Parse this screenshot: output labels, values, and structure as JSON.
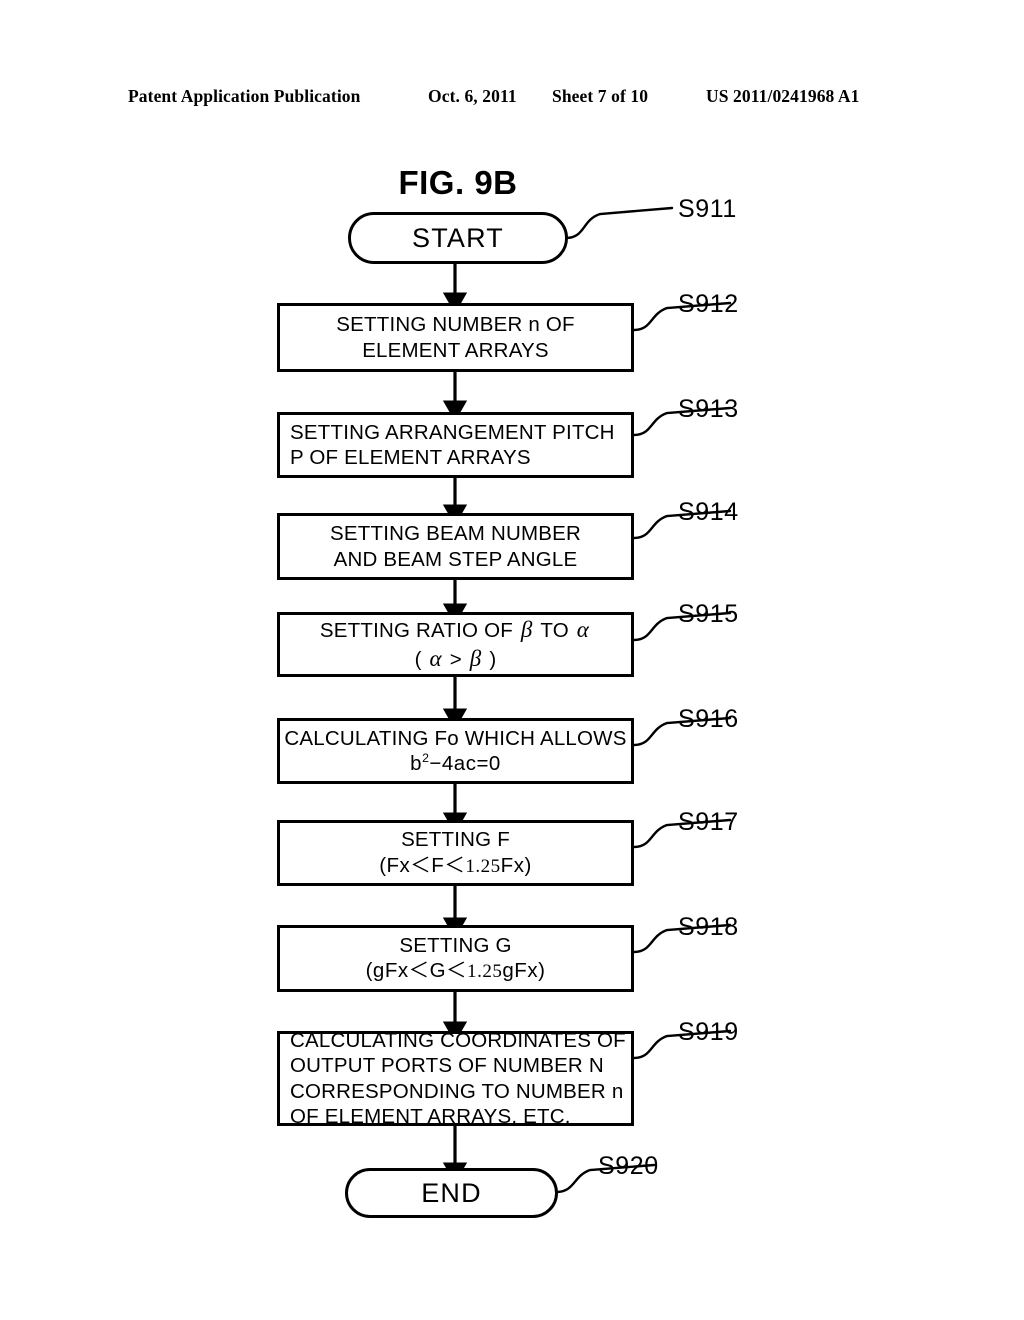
{
  "header": {
    "publication": "Patent Application Publication",
    "date": "Oct. 6, 2011",
    "sheet": "Sheet 7 of 10",
    "patent_number": "US 2011/0241968 A1"
  },
  "figure": {
    "title": "FIG. 9B"
  },
  "flowchart": {
    "type": "flowchart",
    "orientation": "top-to-bottom",
    "nodes": [
      {
        "id": "S911",
        "step_label": "S911",
        "shape": "terminator",
        "align": "center",
        "lines": [
          "START"
        ]
      },
      {
        "id": "S912",
        "step_label": "S912",
        "shape": "process",
        "align": "center",
        "lines": [
          "SETTING NUMBER n OF",
          "ELEMENT ARRAYS"
        ]
      },
      {
        "id": "S913",
        "step_label": "S913",
        "shape": "process",
        "align": "left",
        "lines": [
          "SETTING ARRANGEMENT PITCH",
          "P OF ELEMENT ARRAYS"
        ]
      },
      {
        "id": "S914",
        "step_label": "S914",
        "shape": "process",
        "align": "center",
        "lines": [
          "SETTING BEAM NUMBER",
          "AND BEAM STEP ANGLE"
        ]
      },
      {
        "id": "S915",
        "step_label": "S915",
        "shape": "process",
        "align": "center",
        "lines": [
          "SETTING RATIO OF β TO α",
          "( α > β )"
        ]
      },
      {
        "id": "S916",
        "step_label": "S916",
        "shape": "process",
        "align": "center",
        "lines": [
          "CALCULATING Fo WHICH ALLOWS",
          "b²−4ac=0"
        ]
      },
      {
        "id": "S917",
        "step_label": "S917",
        "shape": "process",
        "align": "center",
        "lines": [
          "SETTING F",
          "(Fx＜F＜1.25Fx)"
        ]
      },
      {
        "id": "S918",
        "step_label": "S918",
        "shape": "process",
        "align": "center",
        "lines": [
          "SETTING G",
          "(gFx＜G＜1.25gFx)"
        ]
      },
      {
        "id": "S919",
        "step_label": "S919",
        "shape": "process",
        "align": "left",
        "lines": [
          "CALCULATING COORDINATES OF",
          "OUTPUT PORTS OF NUMBER N",
          "CORRESPONDING TO NUMBER n",
          "OF ELEMENT ARRAYS, ETC."
        ]
      },
      {
        "id": "S920",
        "step_label": "S920",
        "shape": "terminator",
        "align": "center",
        "lines": [
          "END"
        ]
      }
    ]
  },
  "colors": {
    "ink": "#000000",
    "paper": "#ffffff"
  }
}
